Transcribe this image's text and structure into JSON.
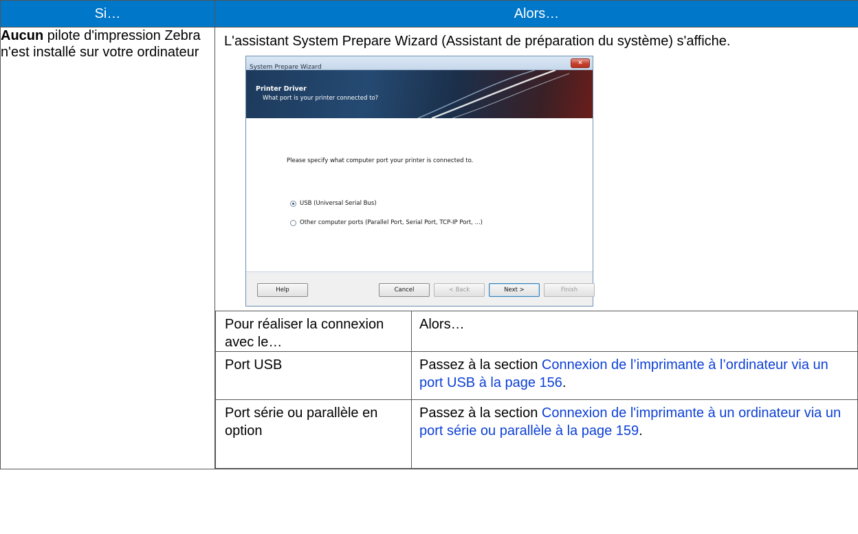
{
  "header": {
    "col1": "Si…",
    "col2": "Alors…"
  },
  "condition": {
    "bold": "Aucun",
    "rest": " pilote d'impression Zebra n'est installé sur votre ordinateur"
  },
  "result_intro": "L'assistant System Prepare Wizard (Assistant de préparation du système) s'affiche.",
  "dialog": {
    "title": "System Prepare Wizard",
    "close": "✕",
    "banner_title": "Printer Driver",
    "banner_subtitle": "What port is your printer connected to?",
    "instruction": "Please specify what computer port your printer is connected to.",
    "options": [
      {
        "label": "USB (Universal Serial Bus)",
        "selected": true
      },
      {
        "label": "Other computer ports (Parallel Port, Serial Port, TCP-IP Port, ...)",
        "selected": false
      }
    ],
    "buttons": {
      "help": "Help",
      "cancel": "Cancel",
      "back": "< Back",
      "next": "Next >",
      "finish": "Finish"
    }
  },
  "inner_table": {
    "header": {
      "col1": "Pour réaliser la connexion avec le…",
      "col2": "Alors…"
    },
    "rows": [
      {
        "port": "Port USB",
        "prefix": "Passez à la section ",
        "link": "Connexion de l’imprimante à l’ordinateur via un port USB à la page 156",
        "suffix": "."
      },
      {
        "port": "Port série ou parallèle en option",
        "prefix": "Passez à la section ",
        "link": "Connexion de l'imprimante à un ordinateur via un port série ou parallèle à la page 159",
        "suffix": "."
      }
    ]
  },
  "colors": {
    "header_bg": "#0077c8",
    "link": "#0b3fd6"
  }
}
